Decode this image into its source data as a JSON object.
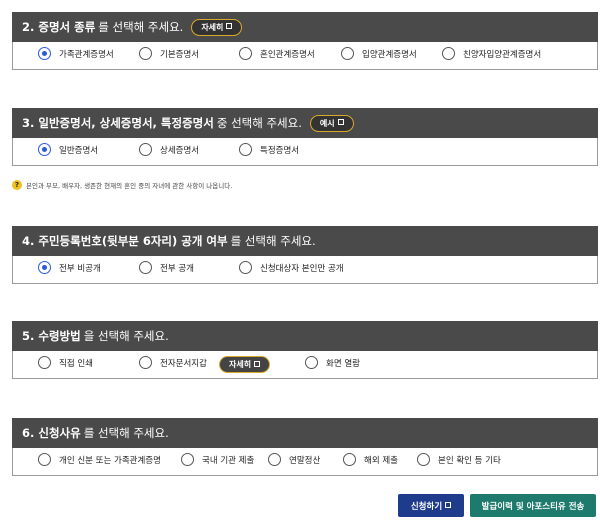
{
  "section2": {
    "title_bold": "2. 증명서 종류",
    "title_rest": "를 선택해 주세요.",
    "help_button": "자세히",
    "options": [
      "가족관계증명서",
      "기본증명서",
      "혼인관계증명서",
      "입양관계증명서",
      "친양자입양관계증명서"
    ],
    "selected": "가족관계증명서"
  },
  "section3": {
    "title_bold": "3. 일반증명서, 상세증명서, 특정증명서",
    "title_rest": "중 선택해 주세요.",
    "help_button": "예시",
    "options": [
      "일반증명서",
      "상세증명서",
      "특정증명서"
    ],
    "selected": "일반증명서",
    "note": "본인과 부모, 배우자, 생존한 현재의 혼인 중의 자녀에 관한 사항이 나옵니다."
  },
  "section4": {
    "title_bold": "4. 주민등록번호(뒷부분 6자리) 공개 여부",
    "title_rest": "를 선택해 주세요.",
    "options": [
      "전부 비공개",
      "전부 공개",
      "신청대상자 본인만 공개"
    ],
    "selected": "전부 비공개"
  },
  "section5": {
    "title_bold": "5. 수령방법",
    "title_rest": "을 선택해 주세요.",
    "options": [
      "직접 인쇄",
      "전자문서지갑",
      "화면 열람"
    ],
    "inline_button": "자세히"
  },
  "section6": {
    "title_bold": "6. 신청사유",
    "title_rest": "를 선택해 주세요.",
    "options": [
      "개인 신분 또는 가족관계증명",
      "국내 기관 제출",
      "연말정산",
      "해외 제출",
      "본인 확인 등 기타"
    ]
  },
  "footer": {
    "apply_button": "신청하기",
    "history_button": "발급이력 및 아포스티유 전송"
  },
  "colors": {
    "header_bg": "#4a4a4a",
    "accent_blue": "#2b5bd7",
    "button_navy": "#1f3c8c",
    "button_teal": "#1d7a6c",
    "gold_border": "#d9a92b"
  }
}
